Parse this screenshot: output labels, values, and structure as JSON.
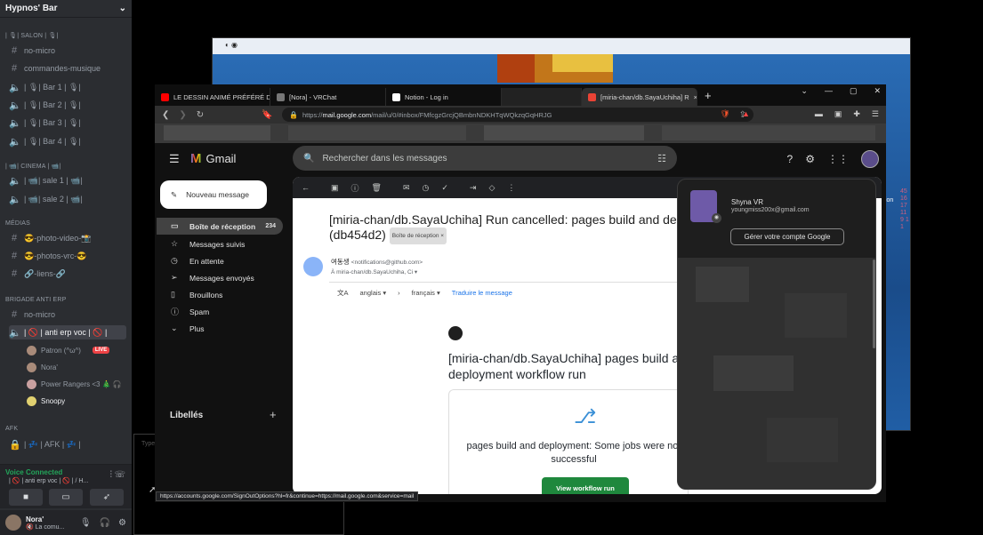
{
  "discord": {
    "server_name": "Hypnos' Bar",
    "categories": [
      {
        "label": "| 🎙| SALON | 🎙|"
      },
      {
        "label": "| 📹| CINEMA | 📹|"
      },
      {
        "label": "MÉDIAS"
      },
      {
        "label": "BRIGADE ANTI ERP"
      },
      {
        "label": "AFK"
      }
    ],
    "channels": [
      {
        "icon": "hash",
        "label": "no-micro"
      },
      {
        "icon": "hash",
        "label": "commandes-musique"
      },
      {
        "icon": "speaker",
        "label": "| 🎙| Bar 1 | 🎙|"
      },
      {
        "icon": "speaker",
        "label": "| 🎙| Bar 2 | 🎙|"
      },
      {
        "icon": "speaker",
        "label": "| 🎙| Bar 3 | 🎙|"
      },
      {
        "icon": "speaker",
        "label": "| 🎙| Bar 4 | 🎙|"
      },
      {
        "icon": "speaker",
        "label": "| 📹| sale 1 | 📹|"
      },
      {
        "icon": "speaker",
        "label": "| 📹| sale 2 | 📹|"
      },
      {
        "icon": "hash",
        "label": "😎-photo-video-📸"
      },
      {
        "icon": "hash",
        "label": "😎-photos-vrc-😎"
      },
      {
        "icon": "hash",
        "label": "🔗-liens-🔗"
      },
      {
        "icon": "hash",
        "label": "no-micro"
      },
      {
        "icon": "speaker",
        "label": "| 🚫 | anti erp voc | 🚫 |"
      },
      {
        "icon": "speaker",
        "label": "| 💤 | AFK | 💤 |"
      }
    ],
    "voice_users": [
      {
        "name": "Patron (^ω^)",
        "live": "LIVE"
      },
      {
        "name": "Nora'"
      },
      {
        "name": "Power Rangers <3 🎄 🎧"
      },
      {
        "name": "Snoopy"
      }
    ],
    "voice_status": "Voice Connected",
    "voice_channel": "| 🚫 | anti erp voc | 🚫 | / H...",
    "user": {
      "name": "Nora'",
      "status": "🔇 La comu..."
    }
  },
  "typebox_placeholder": "Type",
  "browser": {
    "tabs": [
      {
        "label": "LE DESSIN ANIMÉ PRÉFÉRÉ DES AI",
        "color": "#ff0000"
      },
      {
        "label": "[Nora] - VRChat",
        "color": "#888888"
      },
      {
        "label": "Notion - Log in",
        "color": "#ffffff"
      },
      {
        "label": "[miria-chan/db.SayaUchiha] R",
        "color": "#ea4335"
      }
    ],
    "url_prefix": "https://",
    "url_host": "mail.google.com",
    "url_path": "/mail/u/0/#inbox/FMfcgzGrcjQBmbnNDKHTqWQkzqGqHRJG",
    "status_url": "https://accounts.google.com/SignOutOptions?hl=fr&continue=https://mail.google.com&service=mail"
  },
  "gmail": {
    "logo_text": "Gmail",
    "search_placeholder": "Rechercher dans les messages",
    "compose_label": "Nouveau message",
    "nav": [
      {
        "label": "Boîte de réception",
        "count": "234"
      },
      {
        "label": "Messages suivis"
      },
      {
        "label": "En attente"
      },
      {
        "label": "Messages envoyés"
      },
      {
        "label": "Brouillons"
      },
      {
        "label": "Spam"
      },
      {
        "label": "Plus"
      }
    ],
    "labels_heading": "Libellés",
    "mail": {
      "subject": "[miria-chan/db.SayaUchiha] Run cancelled: pages build and deploy",
      "subject_line2": "(db454d2)",
      "badge": "Boîte de réception ×",
      "sender": "여동생",
      "sender_email": "<notifications@github.com>",
      "to": "À miria-chan/db.SayaUchiha, Ci ▾",
      "lang_from": "anglais",
      "lang_to": "français",
      "translate": "Traduire le message",
      "body_title": "[miria-chan/db.SayaUchiha] pages build and deployment workflow run",
      "body_text": "pages build and deployment: Some jobs were not successful",
      "button": "View workflow run"
    },
    "account": {
      "name": "Shyna VR",
      "email": "youngmiss200x@gmail.com",
      "manage_button": "Gérer votre compte Google"
    }
  },
  "side_text": "45 16 17 11 9 1 1",
  "behind_text": "tion",
  "colors": {
    "discord_bg": "#2b2d31",
    "gmail_bg": "#111111",
    "accent_green": "#1f883d",
    "live_red": "#ed4245"
  }
}
